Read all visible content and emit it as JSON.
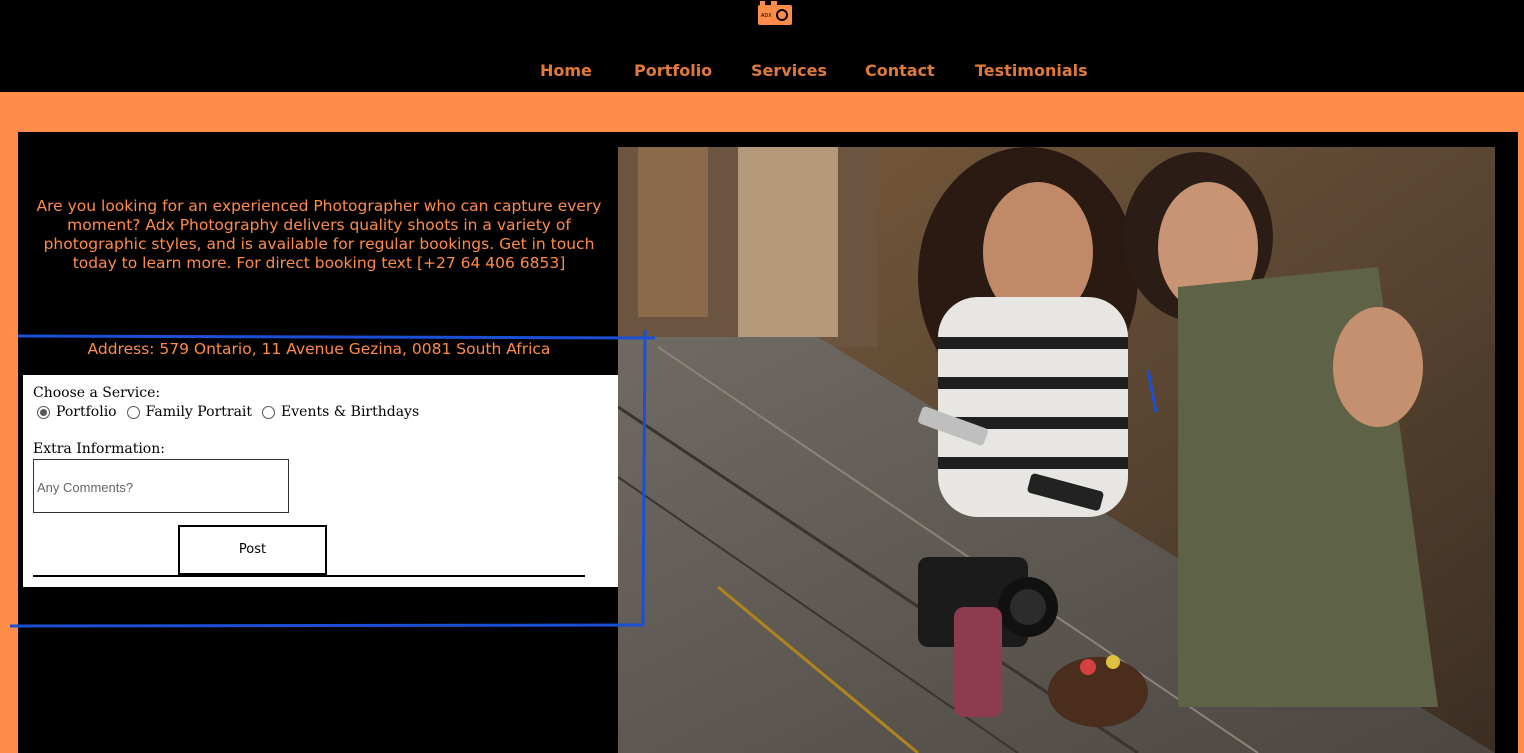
{
  "logo": {
    "icon": "camera-logo-icon",
    "text": "ADX"
  },
  "nav": {
    "items": [
      {
        "label": "Home"
      },
      {
        "label": "Portfolio"
      },
      {
        "label": "Services"
      },
      {
        "label": "Contact"
      },
      {
        "label": "Testimonials"
      }
    ]
  },
  "intro_text": "Are you looking for an experienced Photographer who can capture every moment? Adx Photography delivers quality shoots in a variety of photographic styles, and is available for regular bookings. Get in touch today to learn more. For direct booking text [+27 64 406 6853]",
  "address": "Address: 579 Ontario, 11 Avenue Gezina, 0081 South Africa",
  "form": {
    "choose_label": "Choose a Service:",
    "options": [
      {
        "label": "Portfolio",
        "checked": true
      },
      {
        "label": "Family Portrait",
        "checked": false
      },
      {
        "label": "Events & Birthdays",
        "checked": false
      }
    ],
    "extra_label": "Extra Information:",
    "comments_placeholder": "Any Comments?",
    "submit_label": "Post"
  },
  "colors": {
    "accent": "#ff8c48",
    "nav_text": "#e07a3a",
    "background": "#000000",
    "annotation": "#1a4fd6"
  }
}
